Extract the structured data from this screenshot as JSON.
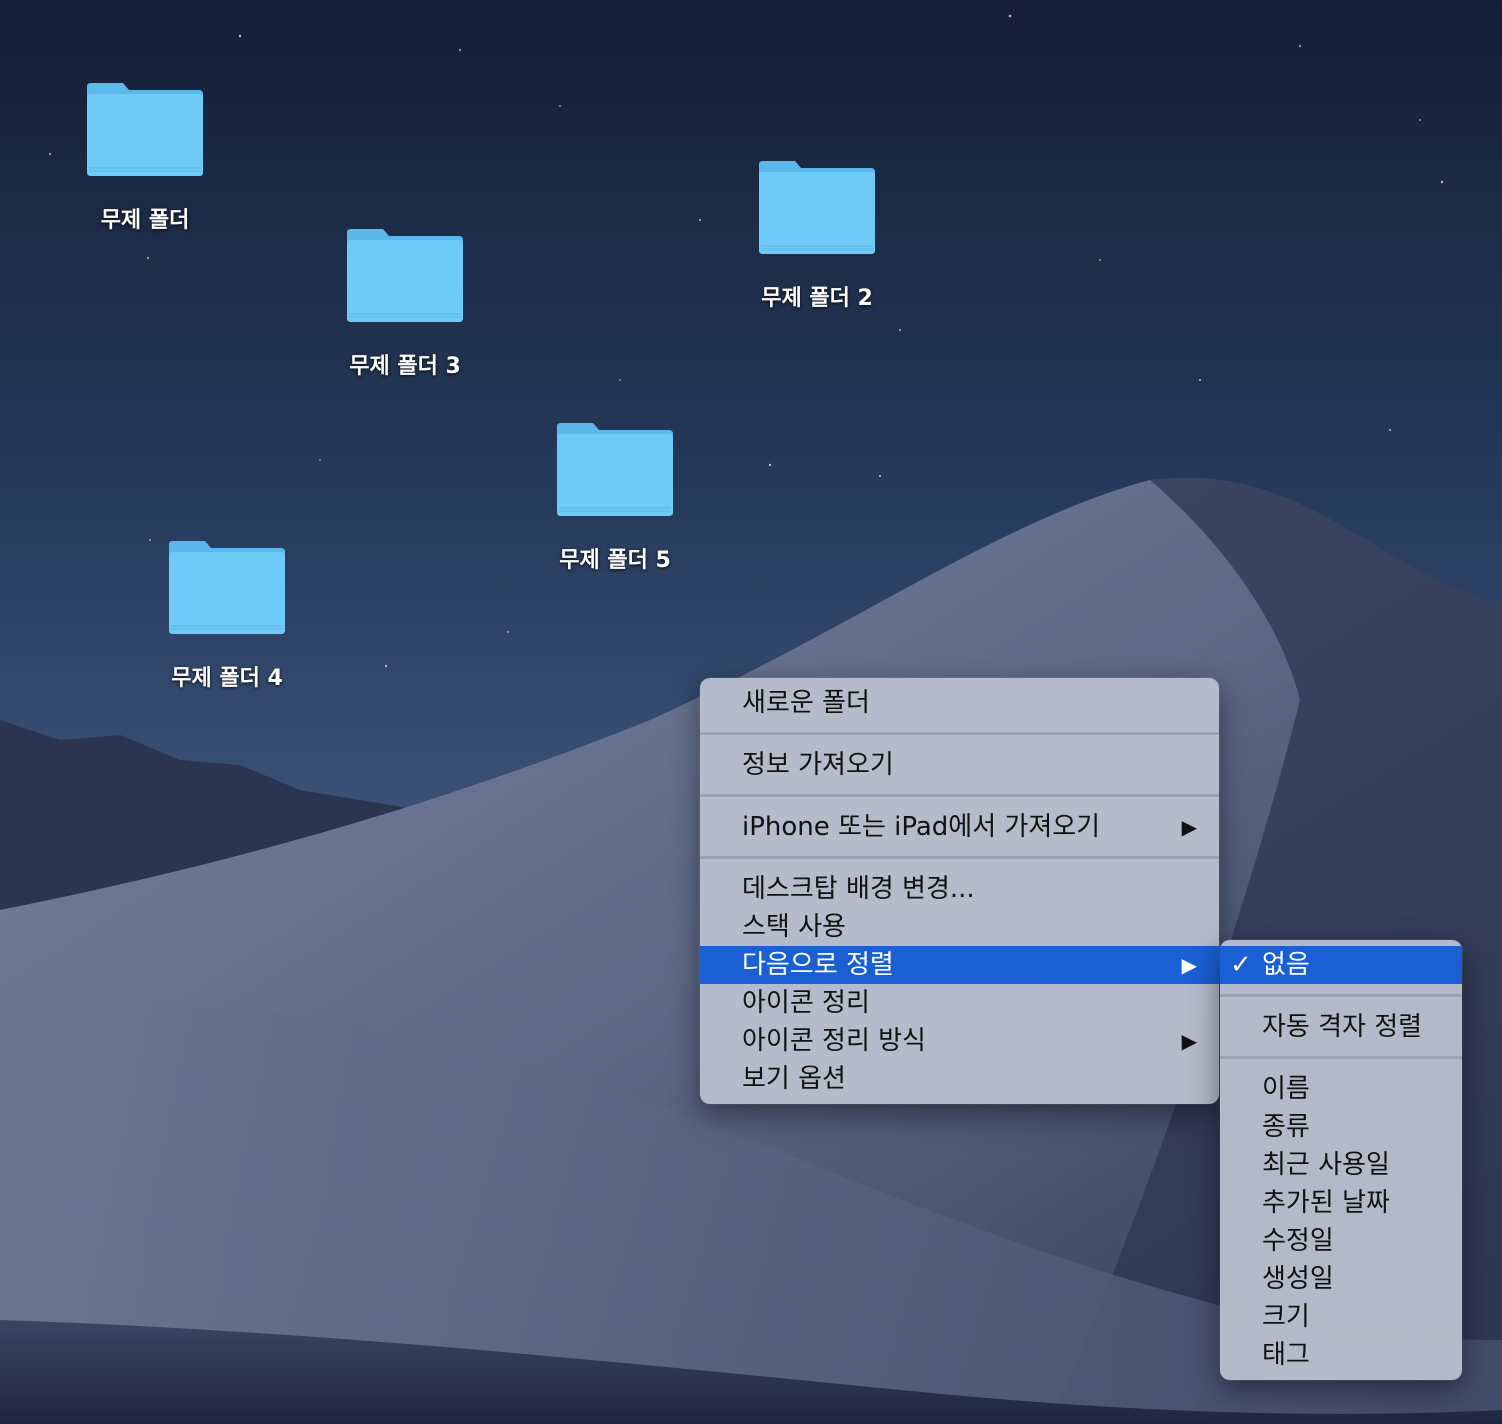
{
  "desktop": {
    "folders": [
      {
        "label": "무제 폴더"
      },
      {
        "label": "무제 폴더 3"
      },
      {
        "label": "무제 폴더 2"
      },
      {
        "label": "무제 폴더 5"
      },
      {
        "label": "무제 폴더 4"
      }
    ],
    "folder_color": "#6ecbf8"
  },
  "context_menu": {
    "items": [
      {
        "label": "새로운 폴더"
      },
      {
        "label": "정보 가져오기"
      },
      {
        "label": "iPhone 또는 iPad에서 가져오기",
        "submenu": true
      },
      {
        "label": "데스크탑 배경 변경..."
      },
      {
        "label": "스택 사용"
      },
      {
        "label": "다음으로 정렬",
        "submenu": true,
        "highlighted": true
      },
      {
        "label": "아이콘 정리"
      },
      {
        "label": "아이콘 정리 방식",
        "submenu": true
      },
      {
        "label": "보기 옵션"
      }
    ],
    "arrow_glyph": "▶",
    "highlight_color": "#1a5fd4"
  },
  "sort_submenu": {
    "check_glyph": "✓",
    "items": [
      {
        "label": "없음",
        "checked": true,
        "highlighted": true
      },
      {
        "label": "자동 격자 정렬"
      },
      {
        "label": "이름"
      },
      {
        "label": "종류"
      },
      {
        "label": "최근 사용일"
      },
      {
        "label": "추가된 날짜"
      },
      {
        "label": "수정일"
      },
      {
        "label": "생성일"
      },
      {
        "label": "크기"
      },
      {
        "label": "태그"
      }
    ]
  }
}
